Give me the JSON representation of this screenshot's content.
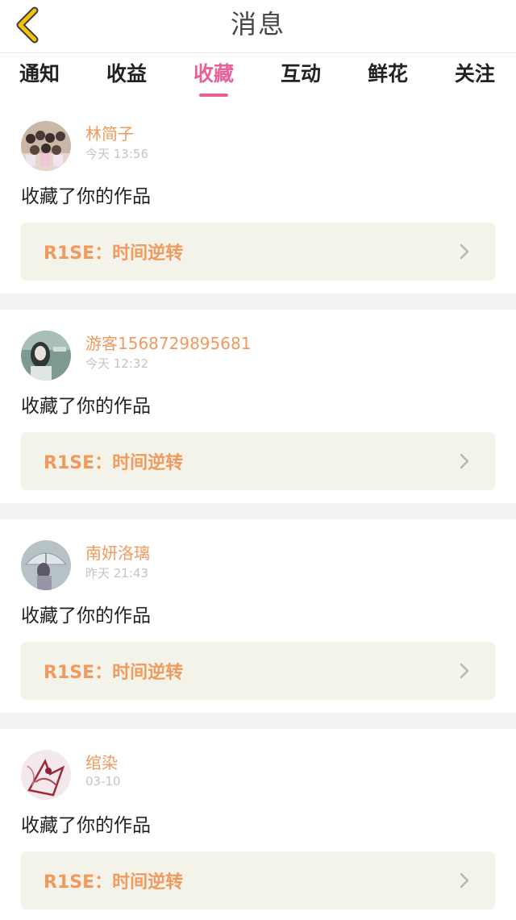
{
  "header": {
    "title": "消息",
    "back_icon": "chevron-left-icon",
    "accent": "#f4c20d"
  },
  "tabs": [
    {
      "label": "通知",
      "active": false
    },
    {
      "label": "收益",
      "active": false
    },
    {
      "label": "收藏",
      "active": true
    },
    {
      "label": "互动",
      "active": false
    },
    {
      "label": "鲜花",
      "active": false
    },
    {
      "label": "关注",
      "active": false
    }
  ],
  "colors": {
    "tab_active": "#e8609a",
    "name": "#f09a5e",
    "card_bg": "#f4f3ea",
    "separator": "#f3f3f3"
  },
  "feed": [
    {
      "user": "林简子",
      "time": "今天 13:56",
      "action": "收藏了你的作品",
      "work": "R1SE：时间逆转"
    },
    {
      "user": "游客1568729895681",
      "time": "今天 12:32",
      "action": "收藏了你的作品",
      "work": "R1SE：时间逆转"
    },
    {
      "user": "南妍洛璃",
      "time": "昨天 21:43",
      "action": "收藏了你的作品",
      "work": "R1SE：时间逆转"
    },
    {
      "user": "绾染",
      "time": "03-10",
      "action": "收藏了你的作品",
      "work": "R1SE：时间逆转"
    }
  ]
}
